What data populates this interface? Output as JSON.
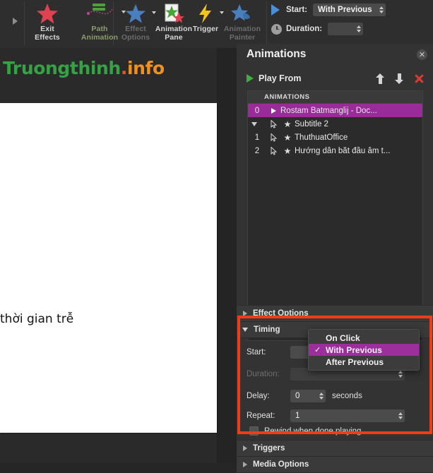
{
  "ribbon": {
    "groups": [
      {
        "buttons": [
          {
            "label_line1": "Exit",
            "label_line2": "Effects",
            "icon": "red-star-icon",
            "state": "enabled"
          },
          {
            "label_line1": "Path",
            "label_line2": "Animation",
            "icon": "motion-path-icon",
            "state": "enabled"
          }
        ]
      },
      {
        "buttons": [
          {
            "label_line1": "Effect",
            "label_line2": "Options",
            "icon": "blue-star-icon",
            "state": "disabled"
          },
          {
            "label_line1": "Animation",
            "label_line2": "Pane",
            "icon": "animation-pane-icon",
            "state": "enabled"
          },
          {
            "label_line1": "Trigger",
            "label_line2": "",
            "icon": "lightning-bolt-icon",
            "state": "enabled"
          },
          {
            "label_line1": "Animation",
            "label_line2": "Painter",
            "icon": "animation-painter-icon",
            "state": "disabled"
          }
        ]
      }
    ],
    "start_label": "Start:",
    "start_value": "With Previous",
    "duration_label": "Duration:",
    "duration_value": ""
  },
  "watermark": {
    "green": "Truongthinh",
    "dot": ".",
    "orange": "info"
  },
  "slide": {
    "text": "thời gian trễ"
  },
  "panel": {
    "title": "Animations",
    "close_label": "✕",
    "play_from_label": "Play From",
    "list_header": "ANIMATIONS",
    "rows": [
      {
        "num": "0",
        "icon": "play-triangle-icon",
        "label": "Rostam Batmanglij - Doc...",
        "selected": true,
        "indent": 0,
        "expander": false
      },
      {
        "num": "",
        "icon": "cursor-click-icon",
        "star": true,
        "label": "Subtitle 2",
        "selected": false,
        "indent": 0,
        "expander": true
      },
      {
        "num": "1",
        "icon": "cursor-click-icon",
        "star": true,
        "label": "ThuthuatOffice",
        "selected": false,
        "indent": 1,
        "expander": false
      },
      {
        "num": "2",
        "icon": "cursor-click-icon",
        "star": true,
        "label": "Hướng dẫn bắt đầu âm t...",
        "selected": false,
        "indent": 1,
        "expander": false
      }
    ],
    "sections": {
      "effect_options": "Effect Options",
      "timing": "Timing",
      "triggers": "Triggers",
      "media_options": "Media Options"
    },
    "timing": {
      "start_label": "Start:",
      "duration_label": "Duration:",
      "duration_value": "",
      "delay_label": "Delay:",
      "delay_value": "0",
      "delay_unit": "seconds",
      "repeat_label": "Repeat:",
      "repeat_value": "1",
      "rewind_label": "Rewind when done playing",
      "rewind_checked": false
    }
  },
  "dropdown": {
    "open": true,
    "check_glyph": "✓",
    "items": [
      {
        "label": "On Click",
        "selected": false
      },
      {
        "label": "With Previous",
        "selected": true
      },
      {
        "label": "After Previous",
        "selected": false
      }
    ]
  },
  "colors": {
    "accent_purple": "#9a2c9a",
    "annotation_red": "#f03c18",
    "play_green": "#3fae3f",
    "delete_red": "#d93b30",
    "watermark_green": "#35a245",
    "watermark_orange": "#f0901e"
  }
}
